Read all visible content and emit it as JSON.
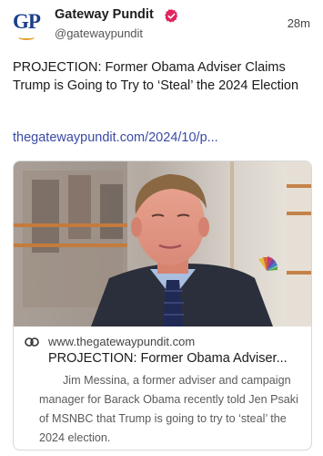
{
  "header": {
    "avatar_text": "GP",
    "name": "Gateway Pundit",
    "handle": "@gatewaypundit",
    "time": "28m"
  },
  "post": {
    "text": "PROJECTION: Former Obama Adviser Claims Trump is Going to Try to ‘Steal’ the 2024 Election",
    "link": "thegatewaypundit.com/2024/10/p..."
  },
  "card": {
    "domain": "www.thegatewaypundit.com",
    "title": "PROJECTION: Former Obama Adviser...",
    "description": "Jim Messina, a former adviser and campaign manager for Barack Obama recently told Jen Psaki of MSNBC that Trump is going to try to ‘steal’ the 2024 election."
  },
  "icons": {
    "verified": "verified-badge-icon",
    "link": "link-icon"
  },
  "colors": {
    "link": "#3b4aa6",
    "verified": "#e0245e",
    "brand_blue": "#1c3f8c",
    "brand_gold": "#e2a12a"
  }
}
